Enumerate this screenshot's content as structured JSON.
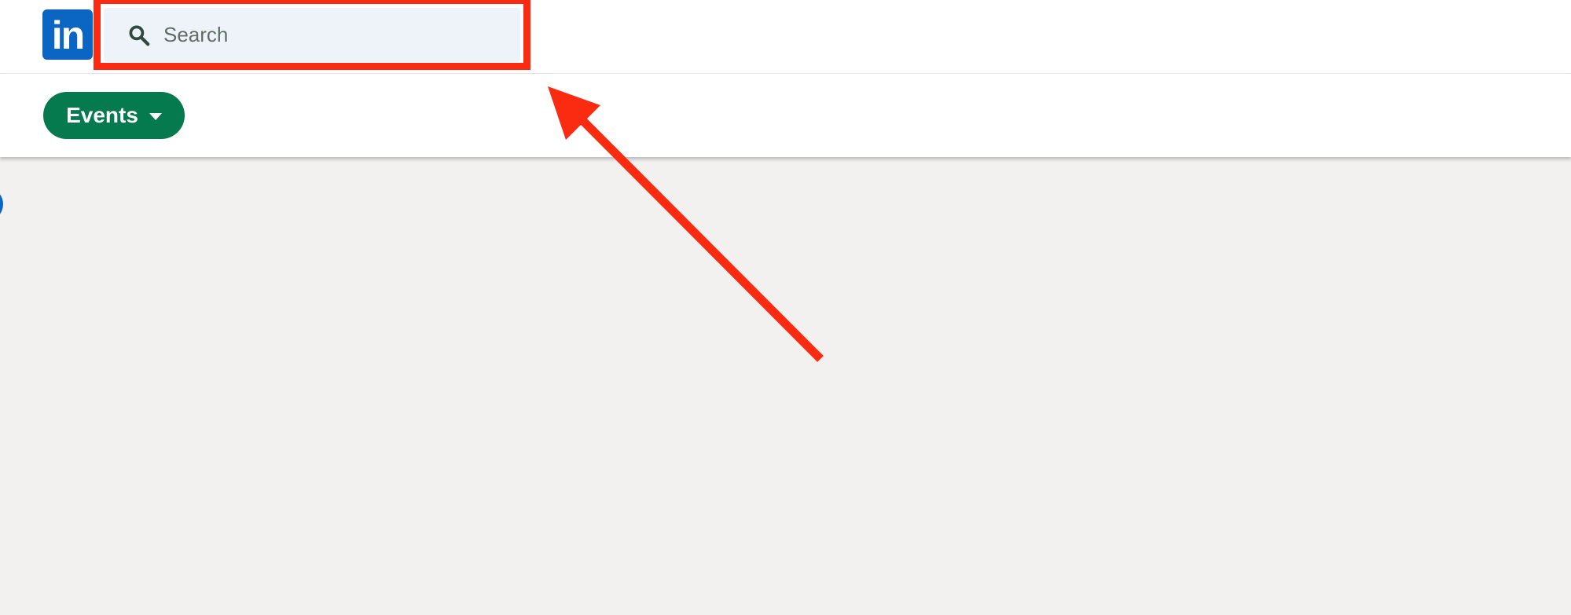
{
  "header": {
    "logo_text": "in",
    "search": {
      "placeholder": "Search",
      "icon": "search-icon"
    }
  },
  "subnav": {
    "events_button": {
      "label": "Events",
      "icon": "caret-down-icon"
    }
  },
  "annotation": {
    "highlight_color": "#fb2b12",
    "arrow_color": "#fb2b12"
  },
  "colors": {
    "brand_blue": "#0a66c2",
    "events_green": "#067a4f",
    "search_bg": "#edf3f8",
    "page_bg": "#f3f1ef"
  }
}
